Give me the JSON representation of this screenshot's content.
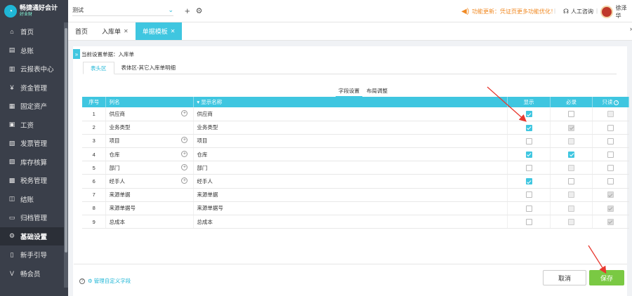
{
  "app": {
    "name": "畅捷通好会计",
    "sub": "好业财"
  },
  "sidebar": {
    "items": [
      {
        "label": "首页",
        "icon": "home-icon",
        "glyph": "⌂"
      },
      {
        "label": "总账",
        "icon": "ledger-icon",
        "glyph": "▤"
      },
      {
        "label": "云报表中心",
        "icon": "chart-icon",
        "glyph": "▥"
      },
      {
        "label": "资金管理",
        "icon": "money-icon",
        "glyph": "¥"
      },
      {
        "label": "固定资产",
        "icon": "asset-icon",
        "glyph": "▦"
      },
      {
        "label": "工资",
        "icon": "salary-icon",
        "glyph": "▣"
      },
      {
        "label": "发票管理",
        "icon": "invoice-icon",
        "glyph": "▧"
      },
      {
        "label": "库存核算",
        "icon": "inventory-icon",
        "glyph": "▨"
      },
      {
        "label": "税务管理",
        "icon": "tax-icon",
        "glyph": "▩"
      },
      {
        "label": "结账",
        "icon": "close-book-icon",
        "glyph": "◫"
      },
      {
        "label": "归档管理",
        "icon": "archive-icon",
        "glyph": "▭"
      },
      {
        "label": "基础设置",
        "icon": "gear-icon",
        "glyph": "⚙"
      },
      {
        "label": "新手引导",
        "icon": "guide-icon",
        "glyph": "▯"
      },
      {
        "label": "畅会员",
        "icon": "vip-icon",
        "glyph": "V"
      }
    ]
  },
  "topbar": {
    "company": "测试",
    "update_notice": "功能更新：凭证页更多功能优化！",
    "support": "人工咨询",
    "user": "徐泽华"
  },
  "tabs": [
    {
      "label": "首页",
      "closable": false
    },
    {
      "label": "入库单",
      "closable": true
    },
    {
      "label": "单据模板",
      "closable": true,
      "active": true
    }
  ],
  "content": {
    "current_doc": "当前设置单据：入库单",
    "area_tabs": [
      "表头区",
      "表体区-其它入库单明细"
    ],
    "sub_tabs": [
      "字段设置",
      "布局调整"
    ],
    "table": {
      "headers": [
        "序号",
        "列名",
        "显示名称",
        "显示",
        "必录",
        "只读"
      ],
      "rows": [
        {
          "no": "1",
          "col": "供应商",
          "plus": true,
          "display": "供应商",
          "show": true,
          "req": false,
          "req_dis": false,
          "ro": false,
          "ro_dis": true
        },
        {
          "no": "2",
          "col": "业务类型",
          "plus": false,
          "display": "业务类型",
          "show": true,
          "req": true,
          "req_dis": true,
          "ro": false,
          "ro_dis": false
        },
        {
          "no": "3",
          "col": "项目",
          "plus": true,
          "display": "项目",
          "show": false,
          "req": false,
          "req_dis": false,
          "ro": false,
          "ro_dis": false
        },
        {
          "no": "4",
          "col": "仓库",
          "plus": true,
          "display": "仓库",
          "show": true,
          "req": true,
          "req_dis": false,
          "ro": false,
          "ro_dis": false
        },
        {
          "no": "5",
          "col": "部门",
          "plus": true,
          "display": "部门",
          "show": false,
          "req": false,
          "req_dis": false,
          "ro": false,
          "ro_dis": false
        },
        {
          "no": "6",
          "col": "经手人",
          "plus": true,
          "display": "经手人",
          "show": true,
          "req": false,
          "req_dis": false,
          "ro": false,
          "ro_dis": false
        },
        {
          "no": "7",
          "col": "来源单据",
          "plus": false,
          "display": "来源单据",
          "show": false,
          "req": false,
          "req_dis": true,
          "ro": true,
          "ro_dis": true
        },
        {
          "no": "8",
          "col": "来源单据号",
          "plus": false,
          "display": "来源单据号",
          "show": false,
          "req": false,
          "req_dis": true,
          "ro": true,
          "ro_dis": true
        },
        {
          "no": "9",
          "col": "总成本",
          "plus": false,
          "display": "总成本",
          "show": false,
          "req": false,
          "req_dis": true,
          "ro": true,
          "ro_dis": true
        }
      ]
    }
  },
  "footer": {
    "manage_link": "管理自定义字段",
    "cancel": "取消",
    "save": "保存"
  },
  "colors": {
    "accent": "#3fc6e0",
    "save": "#7ac943",
    "notice": "#f08a24",
    "arrow": "#e8382f"
  }
}
